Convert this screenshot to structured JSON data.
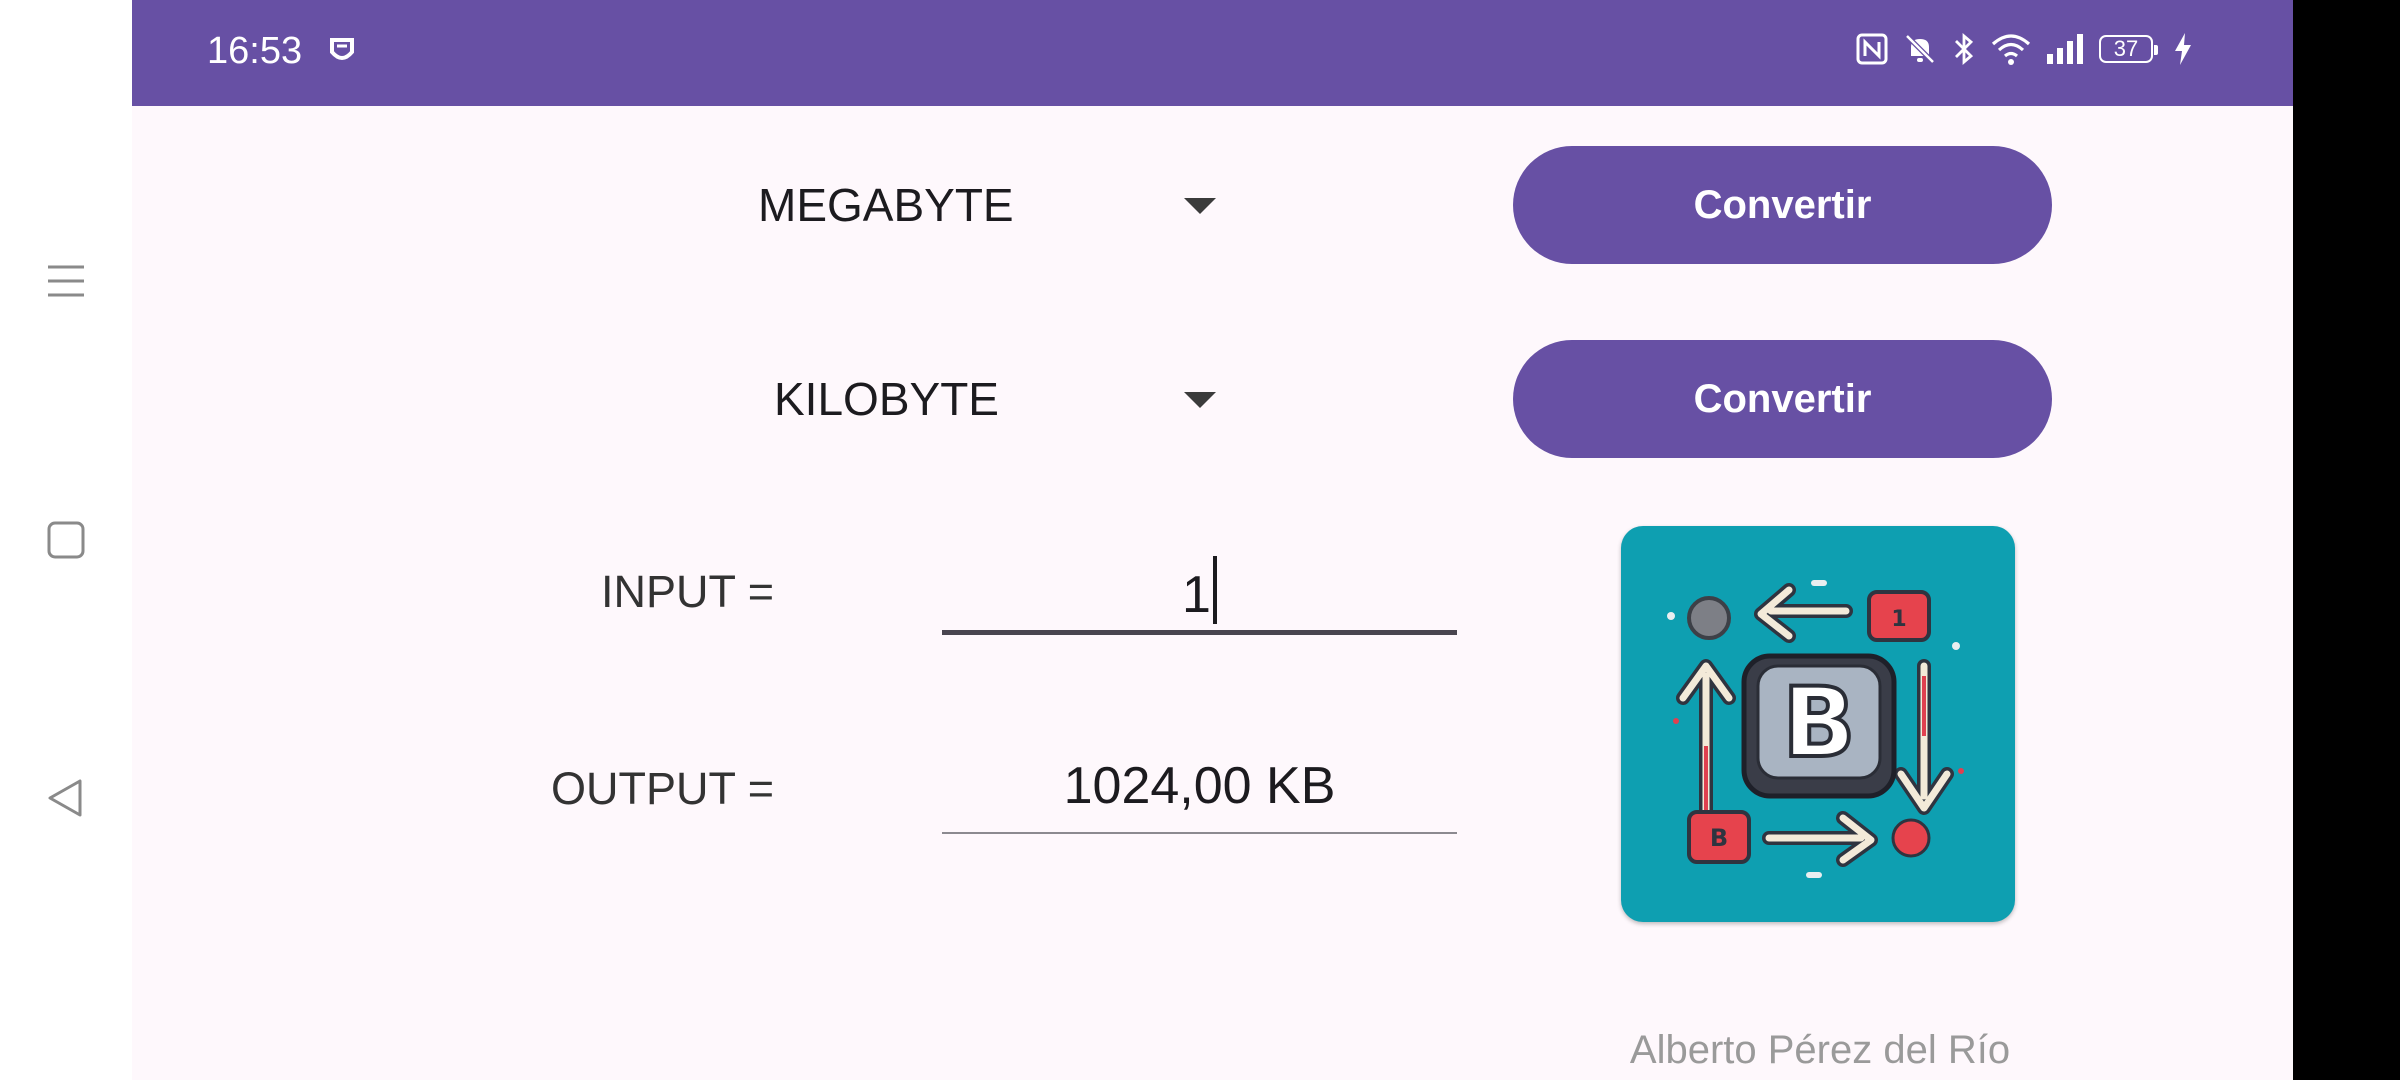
{
  "status_bar": {
    "time": "16:53",
    "battery_level": "37",
    "icons": [
      "shield-app-icon",
      "nfc-icon",
      "bell-off-icon",
      "bluetooth-icon",
      "wifi-icon",
      "signal-icon",
      "battery-icon",
      "charging-icon"
    ]
  },
  "nav_bar": {
    "icons": [
      "menu-icon",
      "home-square-icon",
      "back-triangle-icon"
    ]
  },
  "converter": {
    "from_unit": "MEGABYTE",
    "to_unit": "KILOBYTE",
    "convert_button_1": "Convertir",
    "convert_button_2": "Convertir",
    "input_label": "INPUT =",
    "input_value": "1",
    "output_label": "OUTPUT =",
    "output_value": "1024,00 KB"
  },
  "logo": {
    "letter": "B",
    "badge_top": "1",
    "badge_bottom": "B"
  },
  "footer": {
    "author": "Alberto Pérez del Río"
  },
  "colors": {
    "primary": "#6750a4",
    "background": "#fef8fc",
    "logo_bg": "#0e9fb1"
  }
}
